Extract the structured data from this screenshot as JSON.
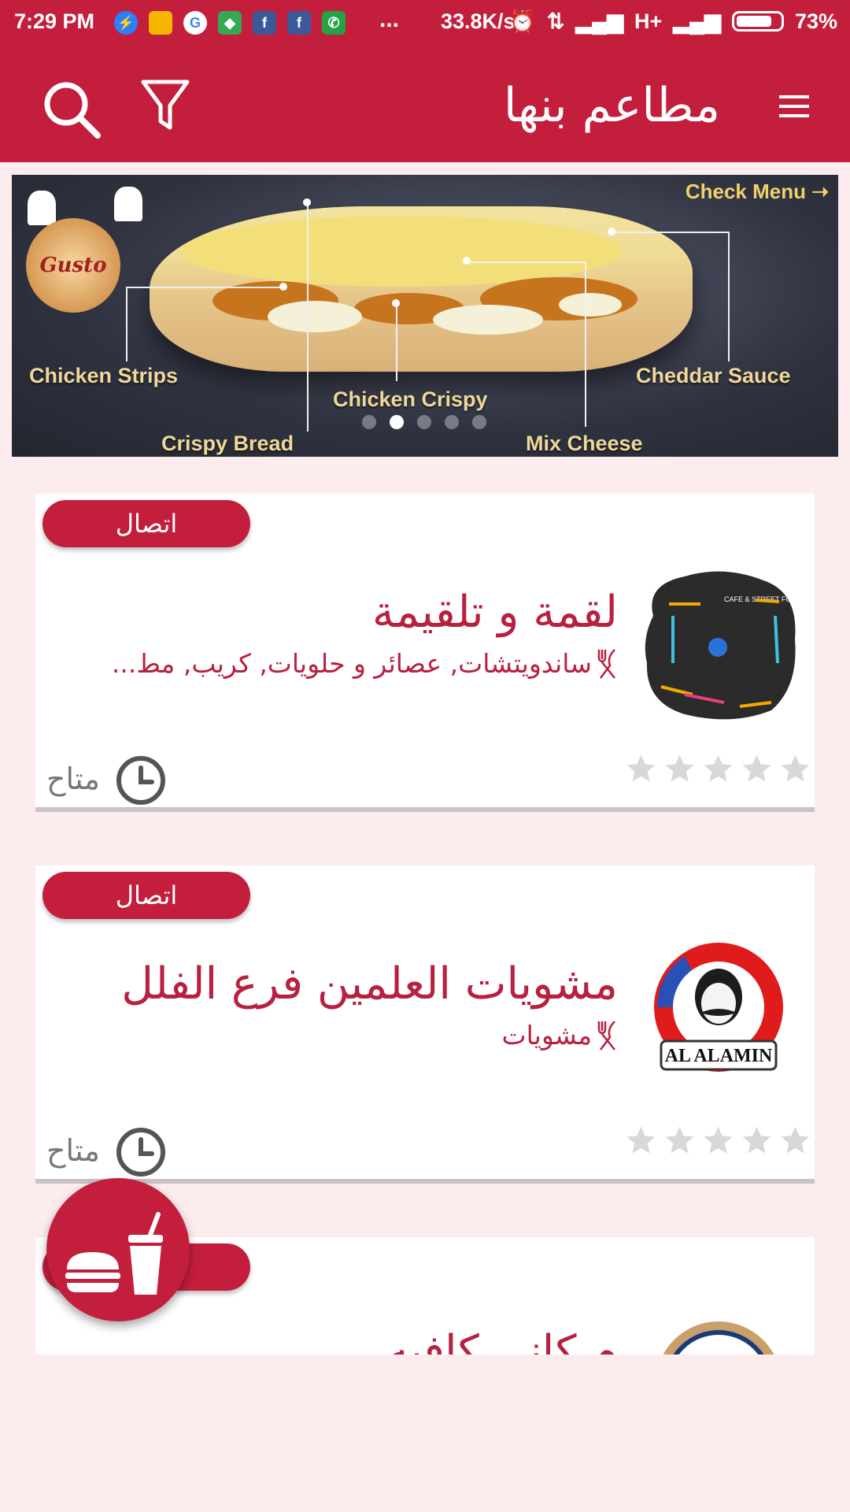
{
  "status_bar": {
    "time": "7:29 PM",
    "more": "...",
    "net_speed": "33.8K/s",
    "network": "H+",
    "battery": "73%",
    "apps": [
      "messenger-icon",
      "notes-icon",
      "google-icon",
      "maps-icon",
      "facebook-icon",
      "facebook-icon",
      "whatsapp-icon"
    ]
  },
  "app_bar": {
    "title": "مطاعم بنها",
    "icons": [
      "search-icon",
      "filter-icon",
      "menu-icon"
    ]
  },
  "banner": {
    "check_menu": "Check  Menu ➝",
    "labels": {
      "chicken_strips": "Chicken Strips",
      "chicken_crispy": "Chicken Crispy",
      "crispy_bread": "Crispy Bread",
      "mix_cheese": "Mix Cheese",
      "cheddar_sauce": "Cheddar Sauce"
    },
    "logo_text": "Gusto",
    "slides": 5,
    "active_slide": 2
  },
  "restaurants": [
    {
      "call_label": "اتصال",
      "name": "لقمة و تلقيمة",
      "categories": "ساندويتشات, عصائر و حلويات, كريب, مط...",
      "status": "متاح",
      "rating": 0,
      "logo": "logo-loqma"
    },
    {
      "call_label": "اتصال",
      "name": "مشويات العلمين فرع الفلل",
      "categories": "مشويات",
      "status": "متاح",
      "rating": 0,
      "logo": "logo-al-alamin",
      "logo_text": "AL ALAMIN"
    },
    {
      "call_label": "اتصال",
      "name": "م كاني كافيه",
      "categories": "",
      "status": "",
      "rating": 0,
      "logo": "logo-kani-cafe"
    }
  ],
  "fab": {
    "icon": "burger-drink-icon"
  },
  "colors": {
    "primary": "#c41e3d",
    "background": "#fdecee",
    "text_accent": "#b8203f"
  }
}
